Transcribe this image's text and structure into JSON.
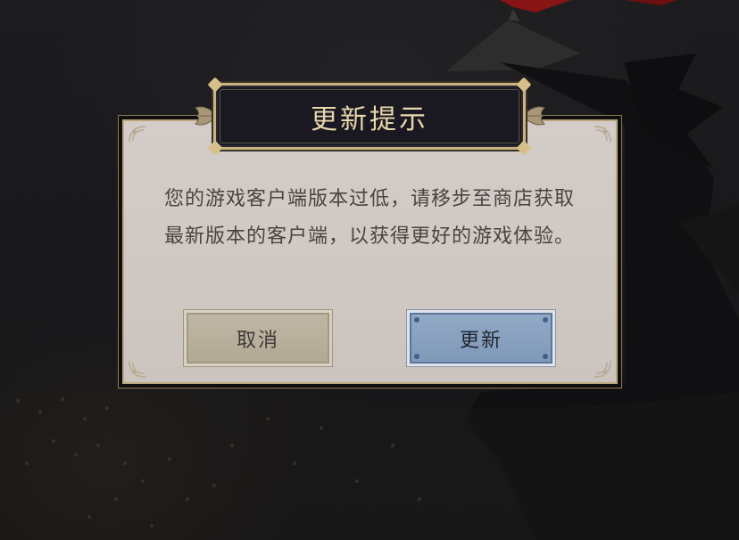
{
  "dialog": {
    "title": "更新提示",
    "message": "您的游戏客户端版本过低，请移步至商店获取最新版本的客户端，以获得更好的游戏体验。"
  },
  "buttons": {
    "cancel_label": "取消",
    "update_label": "更新"
  },
  "colors": {
    "panel_bg": "#cfc8c3",
    "title_plate": "#1a1820",
    "gold_trim": "#c9b37e",
    "title_text": "#e8d8ae",
    "cancel_button": "#b8af9c",
    "update_button": "#88a1c0"
  },
  "icons": {
    "ornament_left": "leaf-ornament-icon",
    "ornament_right": "leaf-ornament-icon",
    "corner_decor": "corner-flourish-icon"
  }
}
